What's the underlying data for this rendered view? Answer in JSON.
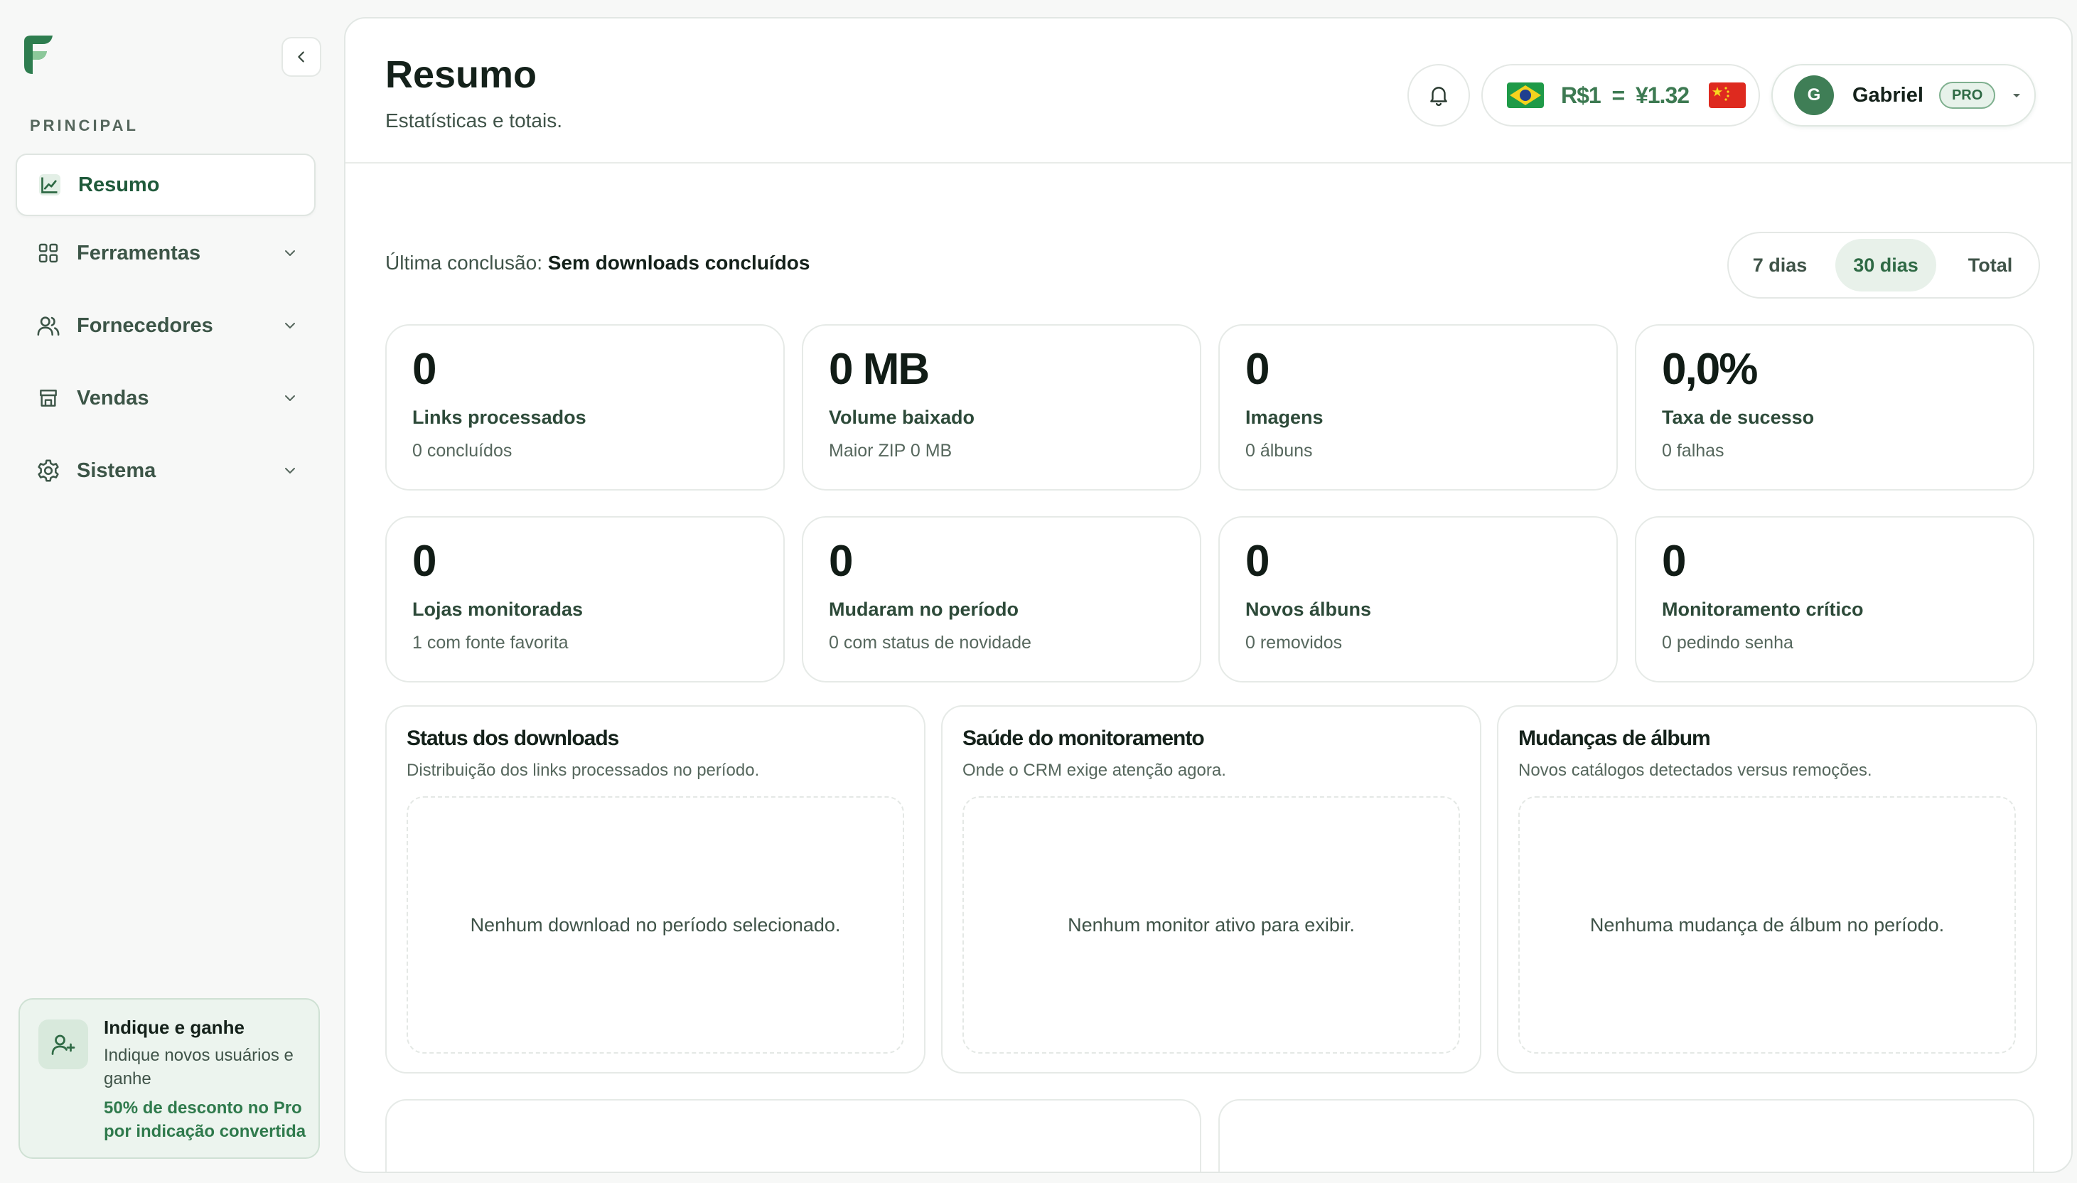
{
  "sidebar": {
    "section_label": "PRINCIPAL",
    "items": [
      {
        "label": "Resumo",
        "icon": "chart-line-icon",
        "active": true
      },
      {
        "label": "Ferramentas",
        "icon": "grid-icon"
      },
      {
        "label": "Fornecedores",
        "icon": "users-icon"
      },
      {
        "label": "Vendas",
        "icon": "store-icon"
      },
      {
        "label": "Sistema",
        "icon": "gear-icon"
      }
    ],
    "referral": {
      "title": "Indique e ganhe",
      "description": "Indique novos usuários e ganhe",
      "promo": "50% de desconto no Pro por indicação convertida"
    }
  },
  "header": {
    "title": "Resumo",
    "subtitle": "Estatísticas e totais.",
    "exchange": "R$1  =  ¥1.32",
    "user": {
      "initial": "G",
      "name": "Gabriel",
      "badge": "PRO"
    }
  },
  "toolbar": {
    "last_done_label": "Última conclusão:",
    "last_done_value": "Sem downloads concluídos",
    "ranges": [
      "7 dias",
      "30 dias",
      "Total"
    ],
    "active_range": "30 dias"
  },
  "stats": [
    {
      "value": "0",
      "label": "Links processados",
      "sub": "0 concluídos"
    },
    {
      "value": "0 MB",
      "label": "Volume baixado",
      "sub": "Maior ZIP 0 MB"
    },
    {
      "value": "0",
      "label": "Imagens",
      "sub": "0 álbuns"
    },
    {
      "value": "0,0%",
      "label": "Taxa de sucesso",
      "sub": "0 falhas"
    },
    {
      "value": "0",
      "label": "Lojas monitoradas",
      "sub": "1 com fonte favorita"
    },
    {
      "value": "0",
      "label": "Mudaram no período",
      "sub": "0 com status de novidade"
    },
    {
      "value": "0",
      "label": "Novos álbuns",
      "sub": "0 removidos"
    },
    {
      "value": "0",
      "label": "Monitoramento crítico",
      "sub": "0 pedindo senha"
    }
  ],
  "panels": [
    {
      "title": "Status dos downloads",
      "subtitle": "Distribuição dos links processados no período.",
      "empty": "Nenhum download no período selecionado."
    },
    {
      "title": "Saúde do monitoramento",
      "subtitle": "Onde o CRM exige atenção agora.",
      "empty": "Nenhum monitor ativo para exibir."
    },
    {
      "title": "Mudanças de álbum",
      "subtitle": "Novos catálogos detectados versus remoções.",
      "empty": "Nenhuma mudança de álbum no período."
    }
  ],
  "colors": {
    "accent": "#2f7a4c",
    "brand": "#3f7e56"
  }
}
